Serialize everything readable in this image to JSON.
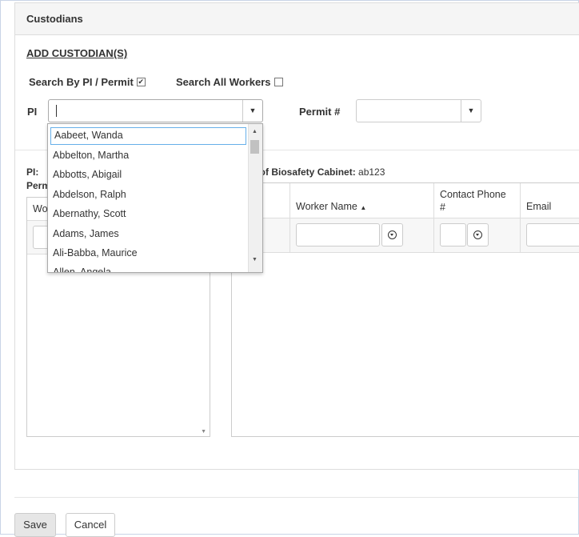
{
  "panel": {
    "title": "Custodians"
  },
  "add_link": "ADD CUSTODIAN(S)",
  "search": {
    "by_pi_label": "Search By PI / Permit",
    "all_workers_label": "Search All Workers"
  },
  "pi_field": {
    "label": "PI",
    "value": ""
  },
  "permit_field": {
    "label": "Permit #",
    "value": ""
  },
  "left_block": {
    "pi_label": "PI:",
    "permit_label": "Perm",
    "grid_col": "Wo"
  },
  "custodians": {
    "label": "dians of Biosafety Cabinet:",
    "cabinet": "ab123",
    "columns": {
      "worker_name": "Worker Name",
      "contact_phone_line1": "Contact Phone",
      "contact_phone_line2": "#",
      "email": "Email"
    },
    "sort_indicator": "▲"
  },
  "dropdown": {
    "search_value": "Aabeet, Wanda",
    "items": [
      "Abbelton, Martha",
      "Abbotts, Abigail",
      "Abdelson, Ralph",
      "Abernathy, Scott",
      "Adams, James",
      "Ali-Babba, Maurice",
      "Allen, Angela"
    ]
  },
  "buttons": {
    "save": "Save",
    "cancel": "Cancel"
  },
  "icons": {
    "checkbox_checked": "✔",
    "dropdown_arrow": "▼",
    "scroll_up": "▲",
    "scroll_down": "▼"
  }
}
